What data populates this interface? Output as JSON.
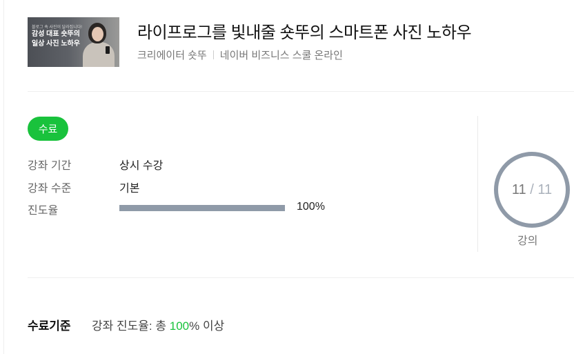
{
  "course": {
    "title": "라이프로그를 빛내줄 숏뚜의 스마트폰 사진 노하우",
    "creator": "크리에이터 숏뚜",
    "platform": "네이버 비즈니스 스쿨 온라인",
    "thumbnail": {
      "small_text": "블로그 속 사진이 달라집니다!",
      "big_text": "감성 대표 숏뚜의\n일상 사진 노하우"
    }
  },
  "status": {
    "badge": "수료",
    "badge_color": "#19c23c"
  },
  "details": {
    "period_label": "강좌 기간",
    "period_value": "상시 수강",
    "level_label": "강좌 수준",
    "level_value": "기본",
    "progress_label": "진도율",
    "progress_fraction": 1.0,
    "progress_text": "100%",
    "progress_color": "#8f9aa8"
  },
  "lectures": {
    "completed": "11",
    "separator": "/",
    "total": "11",
    "label": "강의"
  },
  "criteria": {
    "label": "수료기준",
    "text_prefix": "강좌 진도율: 총 ",
    "percent": "100",
    "text_suffix": "% 이상"
  }
}
